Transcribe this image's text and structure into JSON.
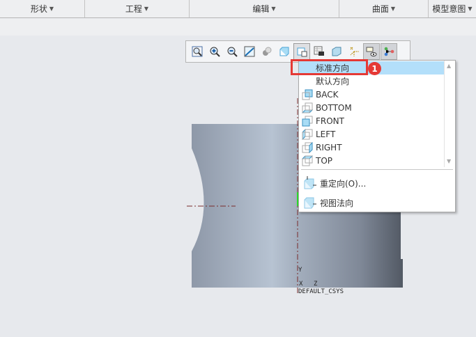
{
  "menubar": {
    "tabs": [
      {
        "label": "形状"
      },
      {
        "label": "工程"
      },
      {
        "label": "编辑"
      },
      {
        "label": "曲面"
      },
      {
        "label": "模型意图"
      }
    ]
  },
  "toolbar": {
    "buttons": [
      "refit-icon",
      "zoom-in-icon",
      "zoom-out-icon",
      "repaint-icon",
      "display-style-icon",
      "saved-orientations-icon",
      "named-views-icon",
      "view-manager-icon",
      "perspective-icon",
      "datum-display-icon",
      "annotation-display-icon",
      "spin-center-icon"
    ]
  },
  "view_menu": {
    "items": [
      {
        "label": "标准方向",
        "highlighted": true
      },
      {
        "label": "默认方向"
      },
      {
        "label": "BACK"
      },
      {
        "label": "BOTTOM"
      },
      {
        "label": "FRONT"
      },
      {
        "label": "LEFT"
      },
      {
        "label": "RIGHT"
      },
      {
        "label": "TOP"
      }
    ],
    "actions": [
      {
        "label": "重定向(O)..."
      },
      {
        "label": "视图法向"
      }
    ]
  },
  "annotation": {
    "badge": "1",
    "highlight_color": "#e53935"
  },
  "csys": {
    "y": "Y",
    "x": "X",
    "z": "Z",
    "name": "DEFAULT_CSYS"
  }
}
